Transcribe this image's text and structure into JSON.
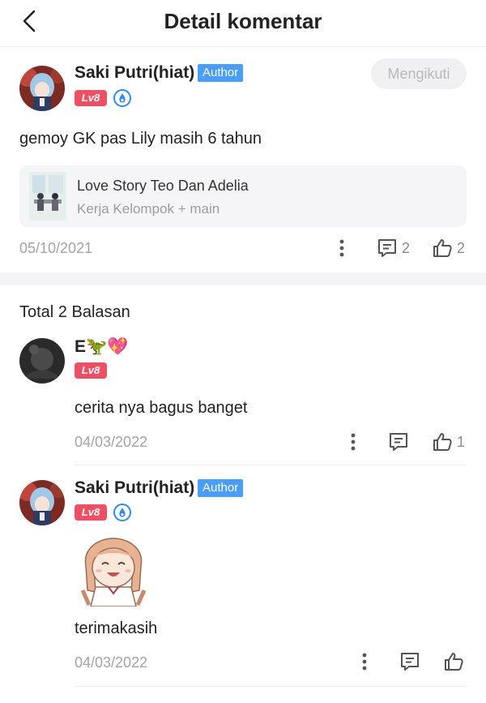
{
  "header": {
    "title": "Detail komentar"
  },
  "main_comment": {
    "user": "Saki Putri(hiat)",
    "author_badge": "Author",
    "level": "Lv8",
    "follow_label": "Mengikuti",
    "text": "gemoy GK pas Lily masih 6 tahun",
    "book": {
      "title": "Love Story Teo Dan Adelia",
      "chapter": "Kerja Kelompok + main"
    },
    "date": "05/10/2021",
    "reply_count": "2",
    "like_count": "2"
  },
  "replies_header": "Total 2 Balasan",
  "replies": [
    {
      "user": "E🦖💖",
      "level": "Lv8",
      "text": "cerita nya bagus banget",
      "date": "04/03/2022",
      "like_count": "1"
    },
    {
      "user": "Saki Putri(hiat)",
      "author_badge": "Author",
      "level": "Lv8",
      "text": "terimakasih",
      "date": "04/03/2022"
    }
  ],
  "colors": {
    "author": "#4a9df8",
    "level": "#ef4f62",
    "vip": "#2f8cf0",
    "muted": "#a3a3a8"
  },
  "icons": [
    "back-icon",
    "more-icon",
    "comment-icon",
    "like-icon",
    "vip-icon"
  ]
}
